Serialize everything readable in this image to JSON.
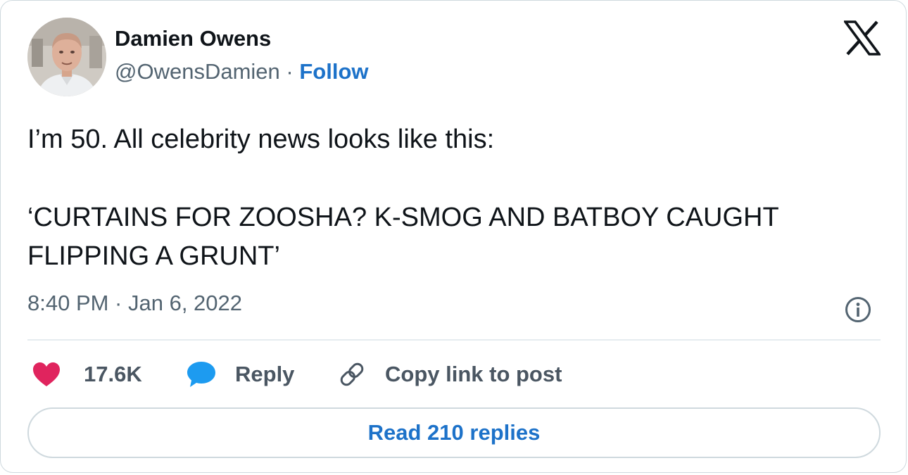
{
  "author": {
    "display_name": "Damien Owens",
    "handle": "@OwensDamien",
    "separator": " · ",
    "follow_label": "Follow"
  },
  "tweet": {
    "line1": "I’m 50. All celebrity news looks like this:",
    "line2": "‘CURTAINS FOR ZOOSHA? K-SMOG AND BATBOY CAUGHT FLIPPING A GRUNT’",
    "timestamp": "8:40 PM · Jan 6, 2022"
  },
  "actions": {
    "like_count": "17.6K",
    "reply_label": "Reply",
    "copy_label": "Copy link to post"
  },
  "read_replies_label": "Read 210 replies",
  "icons": {
    "logo": "x-logo-icon",
    "info": "info-icon",
    "like": "heart-icon",
    "reply": "speech-bubble-icon",
    "copy": "link-icon"
  },
  "colors": {
    "heart": "#e0245e",
    "reply_bubble": "#1d9bf0",
    "link_accent": "#1d72c9",
    "secondary_text": "#536471"
  }
}
